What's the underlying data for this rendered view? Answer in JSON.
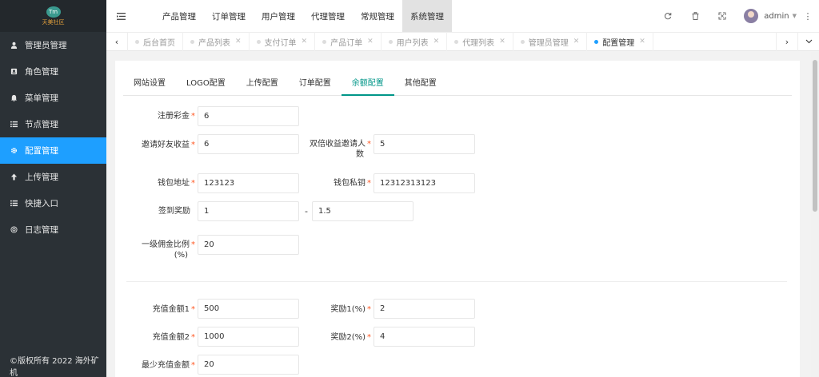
{
  "app": {
    "logo_mark": "Tm",
    "logo_text": "天美社区"
  },
  "sidebar": {
    "items": [
      {
        "label": "管理员管理",
        "icon": "user-icon"
      },
      {
        "label": "角色管理",
        "icon": "role-icon"
      },
      {
        "label": "菜单管理",
        "icon": "bell-icon"
      },
      {
        "label": "节点管理",
        "icon": "list-icon"
      },
      {
        "label": "配置管理",
        "icon": "gear-icon",
        "active": true
      },
      {
        "label": "上传管理",
        "icon": "upload-icon"
      },
      {
        "label": "快捷入口",
        "icon": "list-icon"
      },
      {
        "label": "日志管理",
        "icon": "log-icon"
      }
    ],
    "copyright": "©版权所有 2022 海外矿机"
  },
  "header": {
    "nav": [
      "产品管理",
      "订单管理",
      "用户管理",
      "代理管理",
      "常规管理",
      "系统管理"
    ],
    "active_nav": "系统管理",
    "user": "admin"
  },
  "tabbar": {
    "tabs": [
      "后台首页",
      "产品列表",
      "支付订单",
      "产品订单",
      "用户列表",
      "代理列表",
      "管理员管理",
      "配置管理"
    ],
    "active_tab": "配置管理"
  },
  "config": {
    "subtabs": [
      "网站设置",
      "LOGO配置",
      "上传配置",
      "订单配置",
      "余额配置",
      "其他配置"
    ],
    "active_subtab": "余额配置",
    "fields": {
      "register_bonus": {
        "label": "注册彩金",
        "value": "6"
      },
      "invite_income": {
        "label": "邀请好友收益",
        "value": "6"
      },
      "double_invite_l1": "双倍收益邀请人",
      "double_invite_l2": "数",
      "double_invite_value": "5",
      "wallet_address": {
        "label": "钱包地址",
        "value": "123123"
      },
      "wallet_key": {
        "label": "钱包私钥",
        "value": "12312313123"
      },
      "signin_reward": {
        "label": "签到奖励",
        "min": "1",
        "separator": "-",
        "max": "1.5"
      },
      "commission_l1": "一级佣金比例",
      "commission_l2": "(%)",
      "commission_value": "20",
      "recharge1": {
        "label": "充值金额1",
        "value": "500"
      },
      "reward1": {
        "label": "奖励1(%)",
        "value": "2"
      },
      "recharge2": {
        "label": "充值金额2",
        "value": "1000"
      },
      "reward2": {
        "label": "奖励2(%)",
        "value": "4"
      },
      "min_recharge": {
        "label": "最少充值金额",
        "value": "20"
      }
    }
  }
}
